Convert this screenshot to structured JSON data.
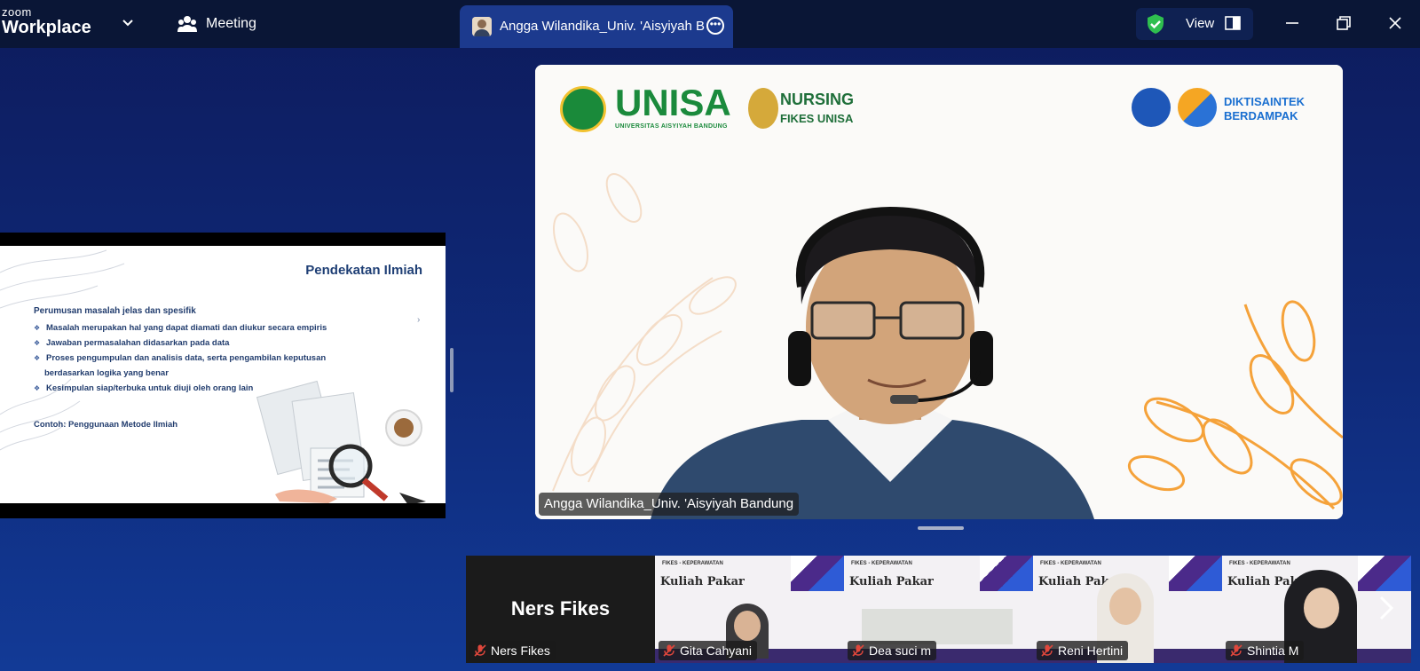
{
  "app": {
    "brand_top": "zoom",
    "brand_bottom": "Workplace",
    "meeting_label": "Meeting"
  },
  "tab": {
    "title": "Angga Wilandika_Univ. 'Aisyiyah B"
  },
  "view_label": "View",
  "slide": {
    "title": "Pendekatan Ilmiah",
    "subtitle": "Perumusan masalah jelas dan spesifik",
    "bullets": [
      "Masalah merupakan hal yang dapat diamati dan diukur secara empiris",
      "Jawaban permasalahan didasarkan pada data",
      "Proses pengumpulan dan analisis data, serta pengambilan keputusan",
      "berdasarkan logika yang benar",
      "Kesimpulan siap/terbuka untuk diuji oleh orang lain"
    ],
    "example": "Contoh: Penggunaan Metode Ilmiah",
    "arrow": "›"
  },
  "speaker": {
    "name": "Angga Wilandika_Univ. 'Aisyiyah Bandung",
    "logos": {
      "unisa": "UNISA",
      "unisa_sub": "UNIVERSITAS AISYIYAH BANDUNG",
      "nursing": "NURSING",
      "fikes": "FIKES UNISA",
      "dikti_1": "DIKTISAINTEK",
      "dikti_2": "BERDAMPAK"
    }
  },
  "gallery": [
    {
      "name": "Ners Fikes",
      "big": "Ners Fikes"
    },
    {
      "name": "Gita Cahyani",
      "bg_title": "Kuliah Pakar",
      "bg_org": "FIKES - KEPERAWATAN"
    },
    {
      "name": "Dea suci m",
      "bg_title": "Kuliah Pakar",
      "bg_org": "FIKES - KEPERAWATAN"
    },
    {
      "name": "Reni Hertini",
      "bg_title": "Kuliah Pakar",
      "bg_org": "FIKES - KEPERAWATAN"
    },
    {
      "name": "Shintia M",
      "bg_title": "Kuliah Pakar",
      "bg_org": "FIKES - KEPERAWATAN"
    }
  ],
  "colors": {
    "bg": "#0f2a7a",
    "topbar": "#0a1636",
    "tab": "#1c3a8e",
    "shield": "#2fbf4f",
    "muted_red": "#e0473c"
  }
}
